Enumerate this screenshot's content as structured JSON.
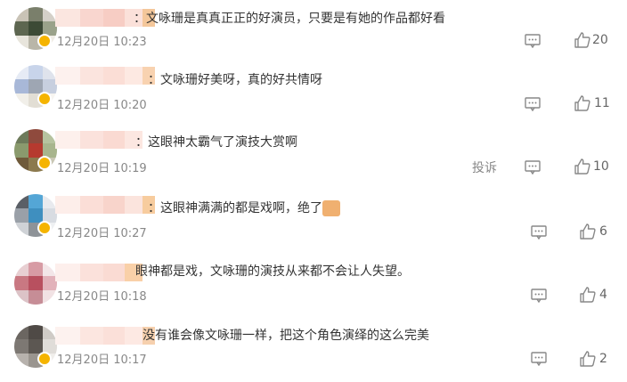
{
  "comments": [
    {
      "text": "：文咏珊是真真正正的好演员，只要是有她的作品都好看",
      "time": "12月20日 10:23",
      "likes": "20",
      "avatar_colors": [
        "#c9c3b6",
        "#7a7f6b",
        "#d4d0c8",
        "#5d6650",
        "#3c4a35",
        "#9aa28a",
        "#e8e5dc",
        "#b9b6a8",
        "#f0ede6"
      ],
      "name_colors": [
        "#fbe6e0",
        "#f9d6cf",
        "#f7cdc4",
        "#fbe1da",
        "#f4c79a"
      ]
    },
    {
      "text": "：文咏珊好美呀，真的好共情呀",
      "time": "12月20日 10:20",
      "likes": "11",
      "avatar_colors": [
        "#e6ebf5",
        "#c8d4ea",
        "#dfe3ec",
        "#a8b8d8",
        "#9ea6b3",
        "#c7cfdf",
        "#f1efe9",
        "#e2ded4",
        "#f7f5f1"
      ],
      "name_colors": [
        "#fdf1ee",
        "#fbe4de",
        "#fbded6",
        "#fde9e2",
        "#f8d2b0"
      ]
    },
    {
      "text": "：这眼神太霸气了演技大赏啊",
      "time": "12月20日 10:19",
      "likes": "10",
      "report": "投诉",
      "avatar_colors": [
        "#6d7a5a",
        "#8f4a3d",
        "#b6c39f",
        "#8a9a6d",
        "#b63a2f",
        "#a8b58d",
        "#6f5a3a",
        "#8c7a4e",
        "#c9c7b5"
      ],
      "name_colors": [
        "#fdf0ec",
        "#fbe2dc",
        "#fadad2",
        "#fce7e1",
        "#ffffff"
      ]
    },
    {
      "text": "：这眼神满满的都是戏啊，绝了",
      "time": "12月20日 10:27",
      "likes": "6",
      "avatar_colors": [
        "#5a5f66",
        "#54a6d6",
        "#e8eaee",
        "#9aa0a8",
        "#3f8fbf",
        "#d8dce2",
        "#cfd2d6",
        "#8e9398",
        "#eef0f2"
      ],
      "name_colors": [
        "#fdeeea",
        "#fbded7",
        "#f8d4cb",
        "#fbe4dd",
        "#f7cc9e"
      ]
    },
    {
      "text": "眼神都是戏，文咏珊的演技从来都不会让人失望。",
      "time": "12月20日 10:18",
      "likes": "4",
      "avatar_colors": [
        "#e8cfd2",
        "#d79ba4",
        "#f3e6e8",
        "#c97882",
        "#b8505f",
        "#e2b2ba",
        "#dcc3c7",
        "#c68d96",
        "#f1e2e4"
      ],
      "name_colors": [
        "#fdefec",
        "#fbe1db",
        "#fadbd3",
        "#f9d0a8",
        "#ffffff"
      ]
    },
    {
      "text": "没有谁会像文咏珊一样，把这个角色演绎的这么完美",
      "time": "12月20日 10:17",
      "likes": "2",
      "avatar_colors": [
        "#6b6661",
        "#4f4a46",
        "#cfcbc6",
        "#7d7873",
        "#5c5752",
        "#e0ddd9",
        "#b7b2ad",
        "#9a958f",
        "#f0eeeb"
      ],
      "name_colors": [
        "#fdf2ef",
        "#fce6e0",
        "#fbe0d9",
        "#fde9e3",
        "#f6d0ae"
      ]
    }
  ],
  "icons": {
    "reply": "comment-icon",
    "like": "thumbs-up-icon",
    "badge": "verified-badge-icon",
    "emoji": "like-emoji"
  }
}
